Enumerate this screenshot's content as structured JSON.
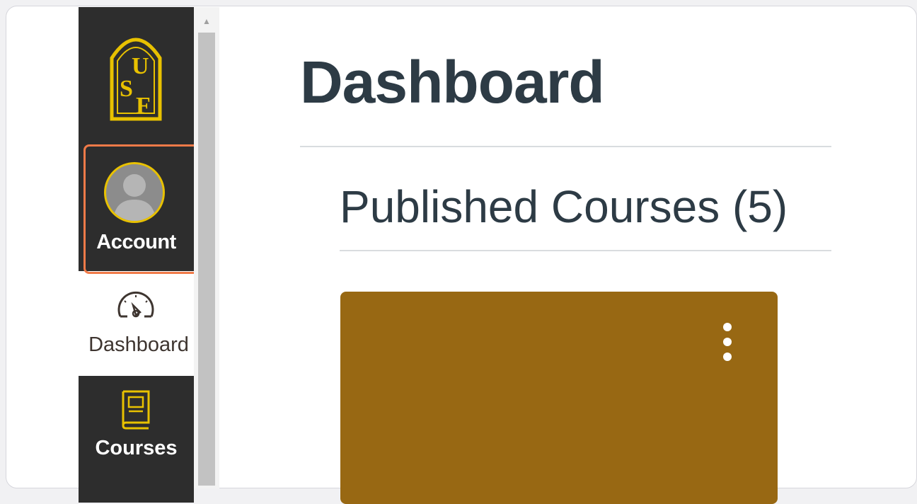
{
  "nav": {
    "logo_letters": [
      "U",
      "S",
      "F"
    ],
    "account_label": "Account",
    "dashboard_label": "Dashboard",
    "courses_label": "Courses"
  },
  "main": {
    "title": "Dashboard",
    "section_title": "Published Courses (5)"
  },
  "colors": {
    "nav_bg": "#2d2d2d",
    "brand_gold": "#e8c100",
    "card_bg": "#986813",
    "title_text": "#2d3b45",
    "highlight": "#f07a48"
  },
  "icons": {
    "logo": "usf-logo-icon",
    "account": "avatar-icon",
    "dashboard": "dashboard-gauge-icon",
    "courses": "book-icon",
    "card_menu": "vertical-dots-icon",
    "scroll_up": "scroll-up-arrow-icon"
  }
}
